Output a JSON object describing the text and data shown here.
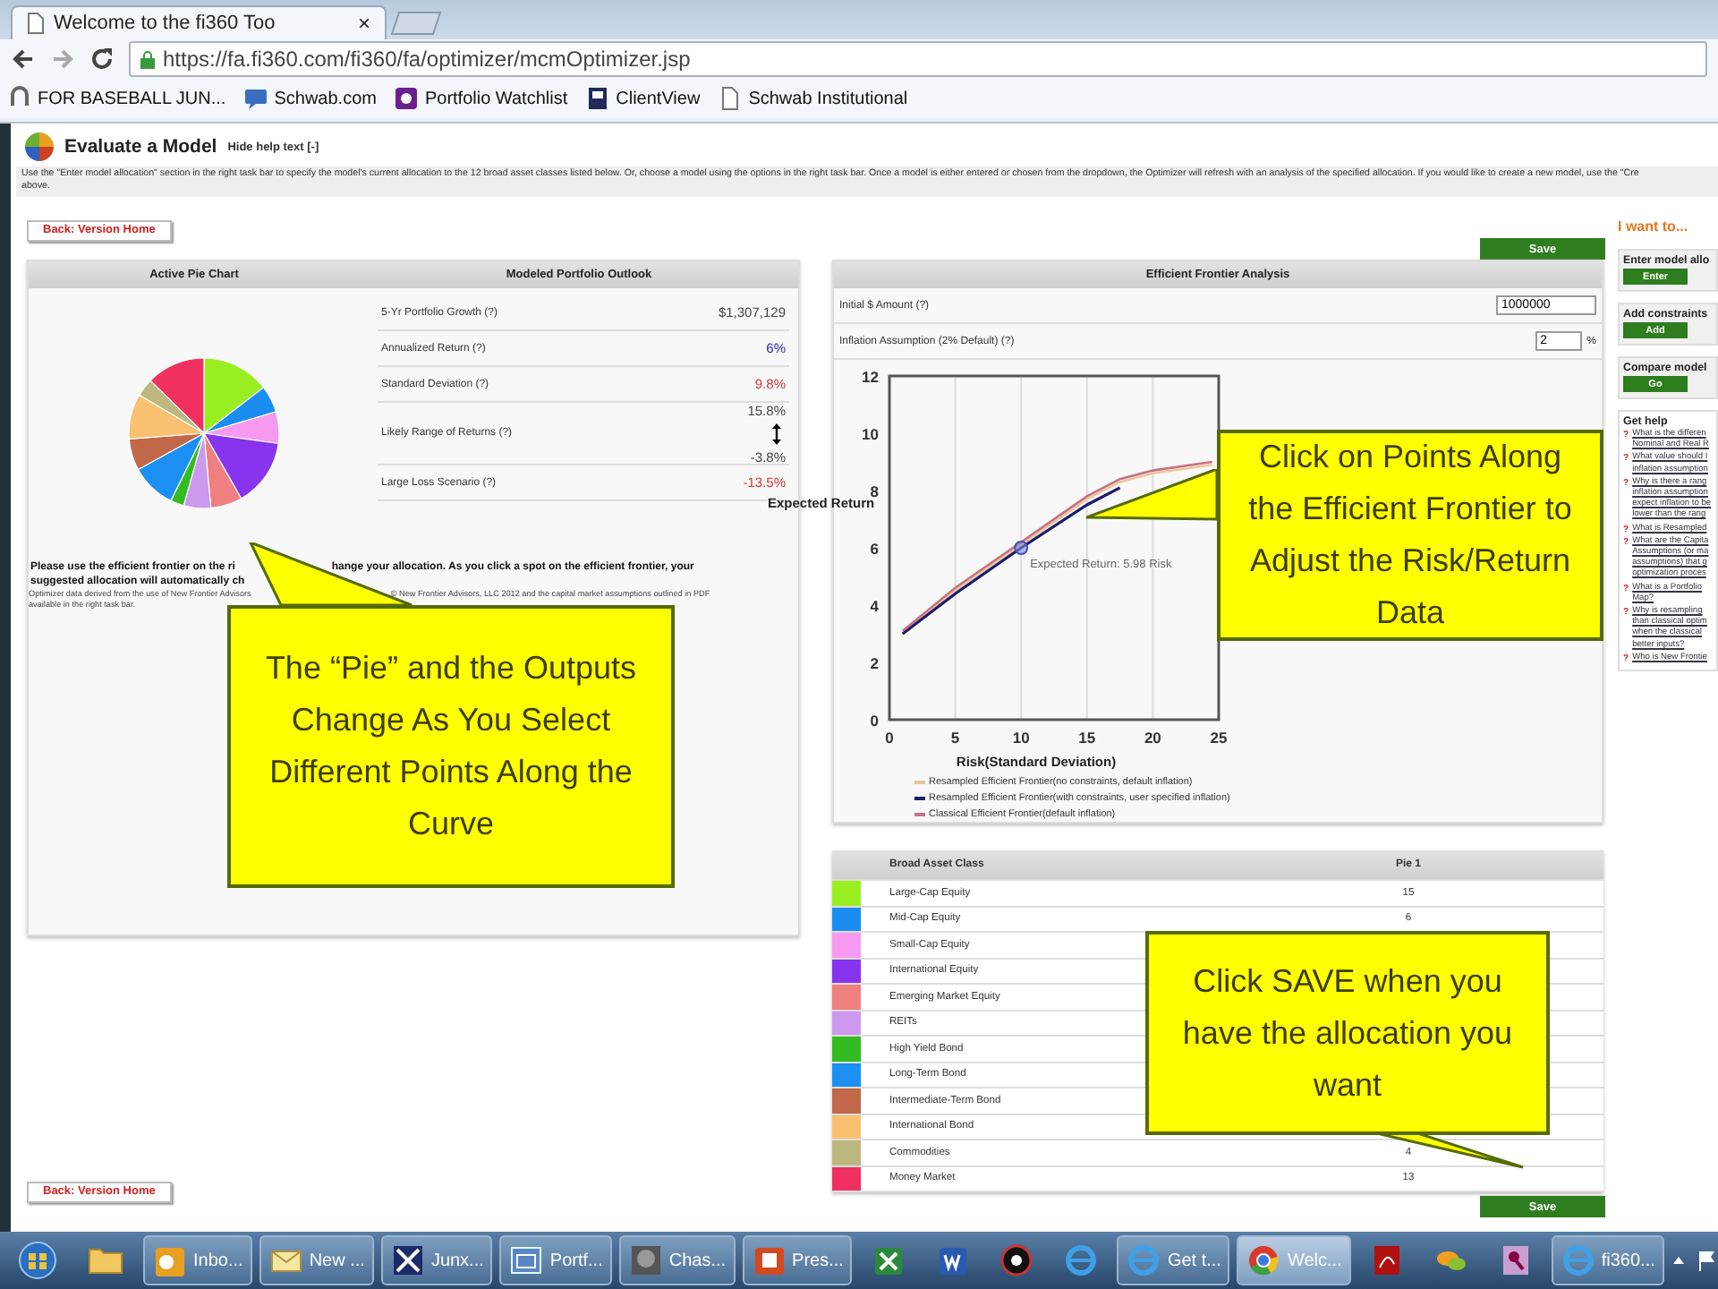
{
  "browser": {
    "tabs": [
      {
        "title": "Welcome to the fi360 Too",
        "close": "×",
        "selected": true
      }
    ],
    "address": "https://fa.fi360.com/fi360/fa/optimizer/mcmOptimizer.jsp",
    "bookmarks": [
      {
        "label": "FOR BASEBALL JUN...",
        "kind": "horseshoe"
      },
      {
        "label": "Schwab.com",
        "kind": "chat"
      },
      {
        "label": "Portfolio Watchlist",
        "kind": "badge"
      },
      {
        "label": "ClientView",
        "kind": "flag"
      },
      {
        "label": "Schwab Institutional",
        "kind": "page"
      }
    ]
  },
  "page_header": {
    "title": "Evaluate a Model",
    "help_toggle": "Hide help text [-]",
    "help_text": [
      "Use the \"Enter model allocation\" section in the right task bar to specify the model's current allocation to the 12 broad asset classes listed below. Or, choose a model using the options in the right task bar. Once a model is either entered or chosen from the dropdown, the Optimizer will refresh with an analysis of the specified allocation. If you would like to create a new model, use the \"Cre",
      "above."
    ]
  },
  "top_actions": {
    "back": "Back: Version Home",
    "save": "Save"
  },
  "outlook_panel": {
    "headings": [
      "Active Pie Chart",
      "Modeled Portfolio Outlook"
    ],
    "stats": [
      {
        "kind": "single",
        "label": "5-Yr Portfolio Growth (?)",
        "value": "$1,307,129",
        "color": "#444444"
      },
      {
        "kind": "single",
        "label": "Annualized Return (?)",
        "value": "6%",
        "color": "#2424c8"
      },
      {
        "kind": "single",
        "label": "Standard Deviation (?)",
        "value": "9.8%",
        "color": "#e03030"
      },
      {
        "kind": "range",
        "label": "Likely Range of Returns (?)",
        "high": "15.8%",
        "low": "-3.8%"
      },
      {
        "kind": "single",
        "label": "Large Loss Scenario (?)",
        "value": "-13.5%",
        "color": "#e03030"
      }
    ],
    "note": [
      [
        "Please use the efficient frontier on the ri",
        "hange your allocation. As you click a spot on the efficient frontier, your"
      ],
      [
        "suggested allocation will automatically ch"
      ]
    ],
    "source_note": [
      [
        "Optimizer data derived from the use of New Frontier Advisors",
        "© New Frontier Advisors, LLC 2012 and the capital market assumptions outlined in PDF"
      ],
      [
        "available in the right task bar."
      ]
    ]
  },
  "frontier_panel": {
    "title": "Efficient Frontier Analysis",
    "fields": [
      {
        "label": "Initial $ Amount (?)",
        "value": "1000000"
      },
      {
        "label": "Inflation Assumption (2% Default) (?)",
        "value": "2",
        "unit": "%"
      }
    ],
    "chart_data": {
      "type": "line",
      "xlabel": "Risk(Standard Deviation)",
      "ylabel": "Expected Return",
      "x": [
        1,
        5,
        10,
        15,
        17.5,
        20,
        24.5
      ],
      "series": [
        {
          "name": "Resampled Efficient Frontier(no constraints, default inflation)",
          "color": "#e8c89a",
          "values": [
            3,
            4.5,
            6.1,
            7.7,
            8.3,
            8.6,
            8.9
          ]
        },
        {
          "name": "Resampled Efficient Frontier(with constraints, user specified inflation)",
          "color": "#1a1a6e",
          "values": [
            3,
            4.4,
            6,
            7.5,
            8.1,
            null,
            null
          ]
        },
        {
          "name": "Classical Efficient Frontier(default inflation)",
          "color": "#c87080",
          "values": [
            3.1,
            4.6,
            6.2,
            7.8,
            8.4,
            8.7,
            9
          ]
        }
      ],
      "grid": true,
      "legend": "bottom",
      "xlim": [
        0,
        25
      ],
      "ylim": [
        0,
        12
      ],
      "xticks": [
        0,
        5,
        10,
        15,
        20,
        25
      ],
      "yticks": [
        0,
        2,
        4,
        6,
        8,
        10,
        12
      ],
      "annotations": [
        {
          "text": "Expected Return: 5.98 Risk",
          "x": 10,
          "y": 6
        }
      ]
    }
  },
  "asset_table": {
    "columns": [
      "Broad Asset Class",
      "Pie 1"
    ],
    "rows": [
      {
        "name": "Large-Cap Equity",
        "color": "#99ee22",
        "value": "15"
      },
      {
        "name": "Mid-Cap Equity",
        "color": "#1a8ef0",
        "value": "6"
      },
      {
        "name": "Small-Cap Equity",
        "color": "#f59af0"
      },
      {
        "name": "International Equity",
        "color": "#8833ee"
      },
      {
        "name": "Emerging Market Equity",
        "color": "#f08080"
      },
      {
        "name": "REITs",
        "color": "#cc99ee"
      },
      {
        "name": "High Yield Bond",
        "color": "#33bb22"
      },
      {
        "name": "Long-Term Bond",
        "color": "#1b90f2"
      },
      {
        "name": "Intermediate-Term Bond",
        "color": "#c06848"
      },
      {
        "name": "International Bond",
        "color": "#f8c070"
      },
      {
        "name": "Commodities",
        "color": "#bdb880",
        "value": "4"
      },
      {
        "name": "Money Market",
        "color": "#f03060",
        "value": "13"
      }
    ]
  },
  "bottom_actions": {
    "back": "Back: Version Home",
    "save": "Save"
  },
  "sidebar": {
    "title": "I want to...",
    "sections": [
      {
        "heading": "Enter model allo",
        "button": "Enter"
      },
      {
        "heading": "Add constraints",
        "button": "Add"
      },
      {
        "heading": "Compare model",
        "button": "Go"
      }
    ],
    "help": {
      "heading": "Get help",
      "links": [
        {
          "mark": "?",
          "lines": [
            "What is the differen",
            "Nominal and Real R"
          ]
        },
        {
          "mark": "?",
          "lines": [
            "What value should I",
            "inflation assumption"
          ]
        },
        {
          "mark": "?",
          "lines": [
            "Why is there a rang",
            "inflation assumption",
            "expect inflation to be",
            "lower than the rang"
          ]
        },
        {
          "mark": "?",
          "lines": [
            "What is Resampled"
          ]
        },
        {
          "mark": "?",
          "lines": [
            "What are the Capita",
            "Assumptions (or ma",
            "assumptions) that g",
            "optimization proces"
          ]
        },
        {
          "mark": "?",
          "lines": [
            "What is a Portfolio",
            "Map?"
          ]
        },
        {
          "mark": "?",
          "lines": [
            "Why is resampling",
            "than classical optim",
            "when the classical",
            "better inputs?"
          ]
        },
        {
          "mark": "?",
          "lines": [
            "Who is New Frontie"
          ]
        }
      ]
    }
  },
  "callouts": [
    {
      "kind": "pie",
      "text": "The “Pie” and the Outputs Change As You Select Different Points Along the Curve"
    },
    {
      "kind": "frontier",
      "text": "Click on Points Along the Efficient Frontier to Adjust the Risk/Return Data"
    },
    {
      "kind": "save",
      "text": "Click SAVE when you have the allocation you want"
    }
  ],
  "taskbar": {
    "items": [
      {
        "kind": "start",
        "selected": false
      },
      {
        "kind": "folder",
        "selected": false
      },
      {
        "kind": "outlook",
        "label": "Inbo...",
        "selected": false
      },
      {
        "kind": "mail",
        "label": "New ...",
        "selected": false
      },
      {
        "kind": "cross",
        "label": "Junx...",
        "selected": false
      },
      {
        "kind": "window",
        "label": "Portf...",
        "selected": false
      },
      {
        "kind": "photo",
        "label": "Chas...",
        "selected": false
      },
      {
        "kind": "slides",
        "label": "Pres...",
        "selected": false
      },
      {
        "kind": "sheet",
        "selected": false
      },
      {
        "kind": "doc",
        "selected": false
      },
      {
        "kind": "circle",
        "selected": false
      },
      {
        "kind": "browser",
        "selected": false
      },
      {
        "kind": "browser",
        "label": "Get t...",
        "selected": false
      },
      {
        "kind": "chrome",
        "label": "Welc...",
        "selected": true
      },
      {
        "kind": "pdf",
        "selected": false
      },
      {
        "kind": "chat",
        "selected": false
      },
      {
        "kind": "key",
        "selected": false
      },
      {
        "kind": "browser",
        "label": "fi360...",
        "selected": false
      }
    ]
  }
}
